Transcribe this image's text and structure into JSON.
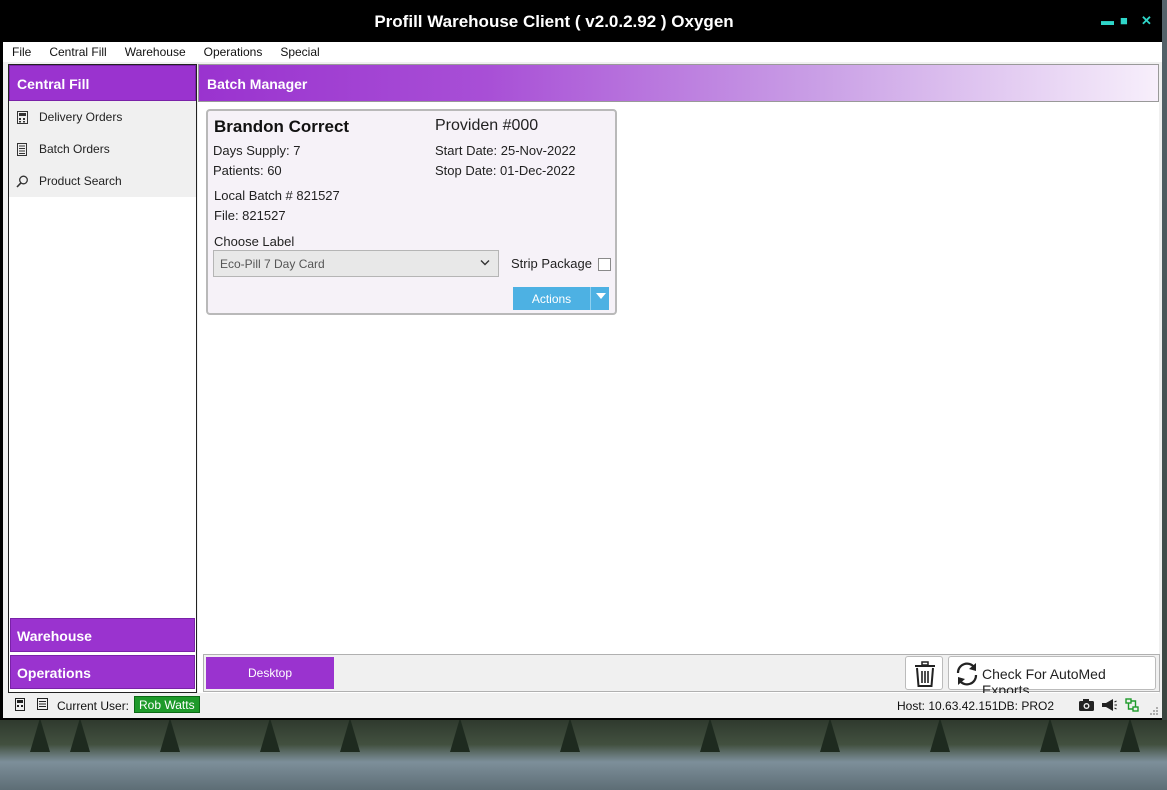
{
  "window": {
    "title": "Profill Warehouse Client ( v2.0.2.92 ) Oxygen",
    "controls": {
      "minimize": "▬",
      "maximize": "■",
      "close": "✕"
    }
  },
  "menu": [
    "File",
    "Central Fill",
    "Warehouse",
    "Operations",
    "Special"
  ],
  "nav": {
    "header": "Central Fill",
    "items": [
      {
        "label": "Delivery Orders",
        "icon": "calculator-icon"
      },
      {
        "label": "Batch Orders",
        "icon": "document-icon"
      },
      {
        "label": "Product Search",
        "icon": "search-icon"
      }
    ],
    "sections": [
      "Warehouse",
      "Operations"
    ]
  },
  "main": {
    "header": "Batch Manager",
    "card": {
      "patient_name": "Brandon Correct",
      "provider": "Providen #000",
      "days_supply": "Days Supply: 7",
      "patients": "Patients: 60",
      "start_date": "Start Date: 25-Nov-2022",
      "stop_date": "Stop Date: 01-Dec-2022",
      "local_batch": "Local Batch # 821527",
      "file": "File:  821527",
      "choose_label": "Choose Label",
      "label_value": "Eco-Pill 7 Day Card",
      "strip_package": "Strip Package",
      "strip_package_checked": false,
      "actions": "Actions"
    },
    "bottom": {
      "desktop": "Desktop",
      "check_exports": "Check For AutoMed Exports"
    }
  },
  "status": {
    "current_user_label": "Current User:",
    "current_user": "Rob Watts",
    "host": "Host: 10.63.42.151",
    "db": "DB: PRO2"
  },
  "colors": {
    "accent": "#9a33cf",
    "actions_button": "#4db1e3",
    "user_badge": "#1e9a2a",
    "window_control": "#2fd6c9"
  }
}
